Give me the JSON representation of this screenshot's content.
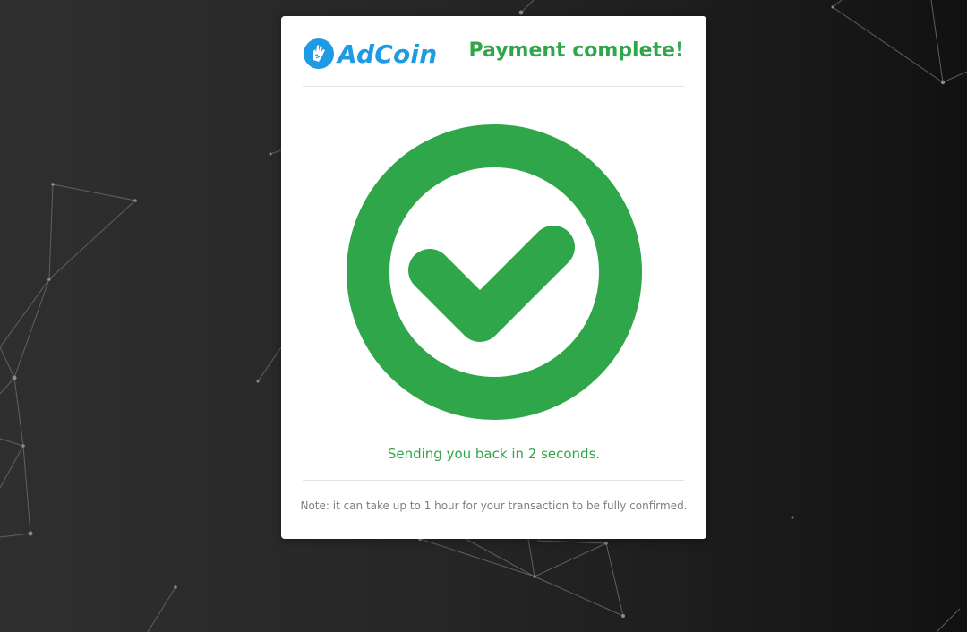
{
  "brand": {
    "name": "AdCoin",
    "color": "#1e9be3",
    "icon": "adcoin-hand-logo-icon"
  },
  "status": {
    "title": "Payment complete!",
    "color": "#2ea649",
    "icon": "checkmark-circle-icon"
  },
  "redirect": {
    "message": "Sending you back in 2 seconds."
  },
  "note": {
    "text": "Note: it can take up to 1 hour for your transaction to be fully confirmed."
  },
  "theme": {
    "background": "#262626",
    "card": "#ffffff",
    "network_lines": "#6a6a6a"
  }
}
